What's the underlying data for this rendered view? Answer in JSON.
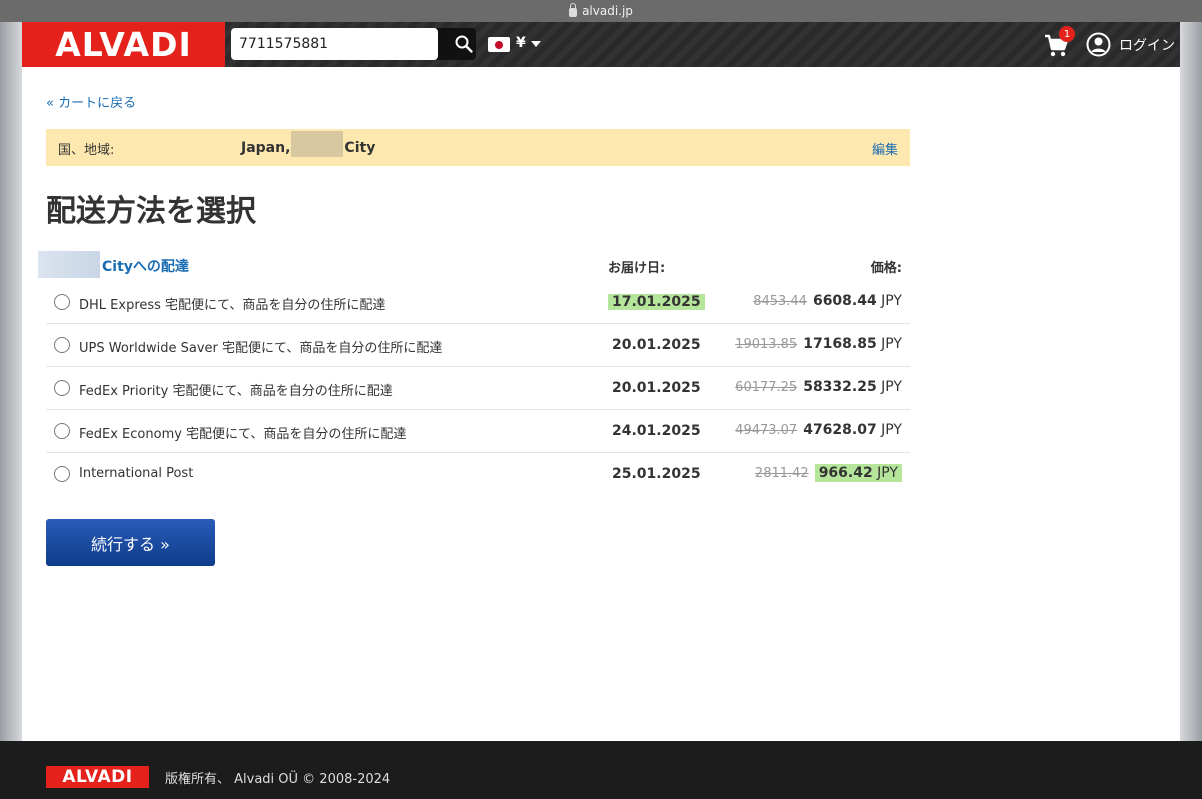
{
  "browser": {
    "url": "alvadi.jp"
  },
  "header": {
    "logo": "ALVADI",
    "search_value": "7711575881",
    "currency": "¥",
    "cart_count": "1",
    "login_label": "ログイン"
  },
  "nav": {
    "back_label": "« カートに戻る"
  },
  "country": {
    "label": "国、地域:",
    "value_before": "Japan,",
    "value_after": "City",
    "edit_label": "編集"
  },
  "page_title": "配送方法を選択",
  "delivery": {
    "city_title": "Cityへの配達",
    "date_header": "お届け日:",
    "price_header": "価格:",
    "options": [
      {
        "label": "DHL Express 宅配便にて、商品を自分の住所に配達",
        "date": "17.01.2025",
        "old_price": "8453.44",
        "price": "6608.44",
        "currency": "JPY"
      },
      {
        "label": "UPS Worldwide Saver 宅配便にて、商品を自分の住所に配達",
        "date": "20.01.2025",
        "old_price": "19013.85",
        "price": "17168.85",
        "currency": "JPY"
      },
      {
        "label": "FedEx Priority 宅配便にて、商品を自分の住所に配達",
        "date": "20.01.2025",
        "old_price": "60177.25",
        "price": "58332.25",
        "currency": "JPY"
      },
      {
        "label": "FedEx Economy 宅配便にて、商品を自分の住所に配達",
        "date": "24.01.2025",
        "old_price": "49473.07",
        "price": "47628.07",
        "currency": "JPY"
      },
      {
        "label": "International Post",
        "date": "25.01.2025",
        "old_price": "2811.42",
        "price": "966.42",
        "currency": "JPY"
      }
    ]
  },
  "continue_label": "続行する »",
  "footer": {
    "logo": "ALVADI",
    "copyright": "版権所有、 Alvadi OÜ © 2008-2024"
  },
  "colors": {
    "brand_red": "#e4221b",
    "link_blue": "#1a6db3",
    "highlight_green": "#b5e59a",
    "notice_yellow": "#fde8b0",
    "button_blue": "#1a4ea0"
  }
}
